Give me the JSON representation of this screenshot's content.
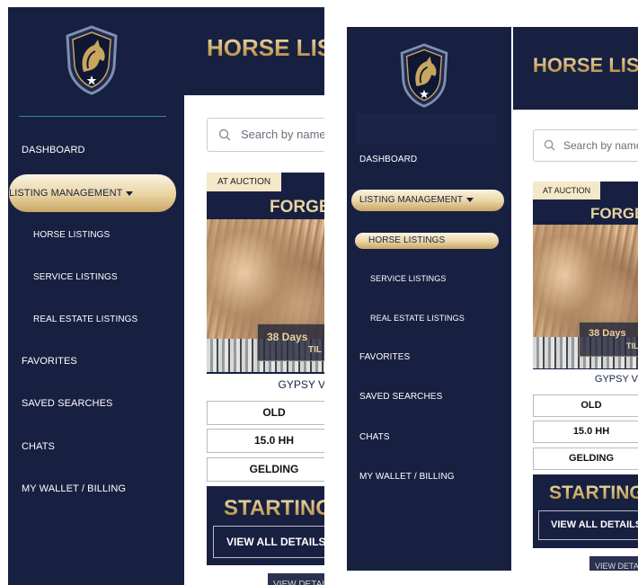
{
  "brand": {
    "logo": "horse-shield-logo"
  },
  "header": {
    "title": "HORSE LISTINGS"
  },
  "nav": {
    "dashboard": "DASHBOARD",
    "listing_management": "LISTING MANAGEMENT",
    "horse_listings": "HORSE LISTINGS",
    "service_listings": "SERVICE LISTINGS",
    "real_estate_listings": "REAL ESTATE LISTINGS",
    "favorites": "FAVORITES",
    "saved_searches": "SAVED SEARCHES",
    "chats": "CHATS",
    "wallet": "MY WALLET / BILLING"
  },
  "search": {
    "placeholder": "Search by name"
  },
  "listing": {
    "badge": "AT AUCTION",
    "name": "FORGE",
    "timer": "38 Days",
    "timer_sub": "TIL",
    "breed": "GYPSY V",
    "age": "OLD",
    "height": "15.0 HH",
    "sex": "GELDING",
    "price_label": "STARTING",
    "view_all": "VIEW ALL DETAILS",
    "view_details": "VIEW DETAILS"
  },
  "colors": {
    "navy": "#182042",
    "gold": "#c9a65e",
    "pill": "#e9d3a1"
  }
}
